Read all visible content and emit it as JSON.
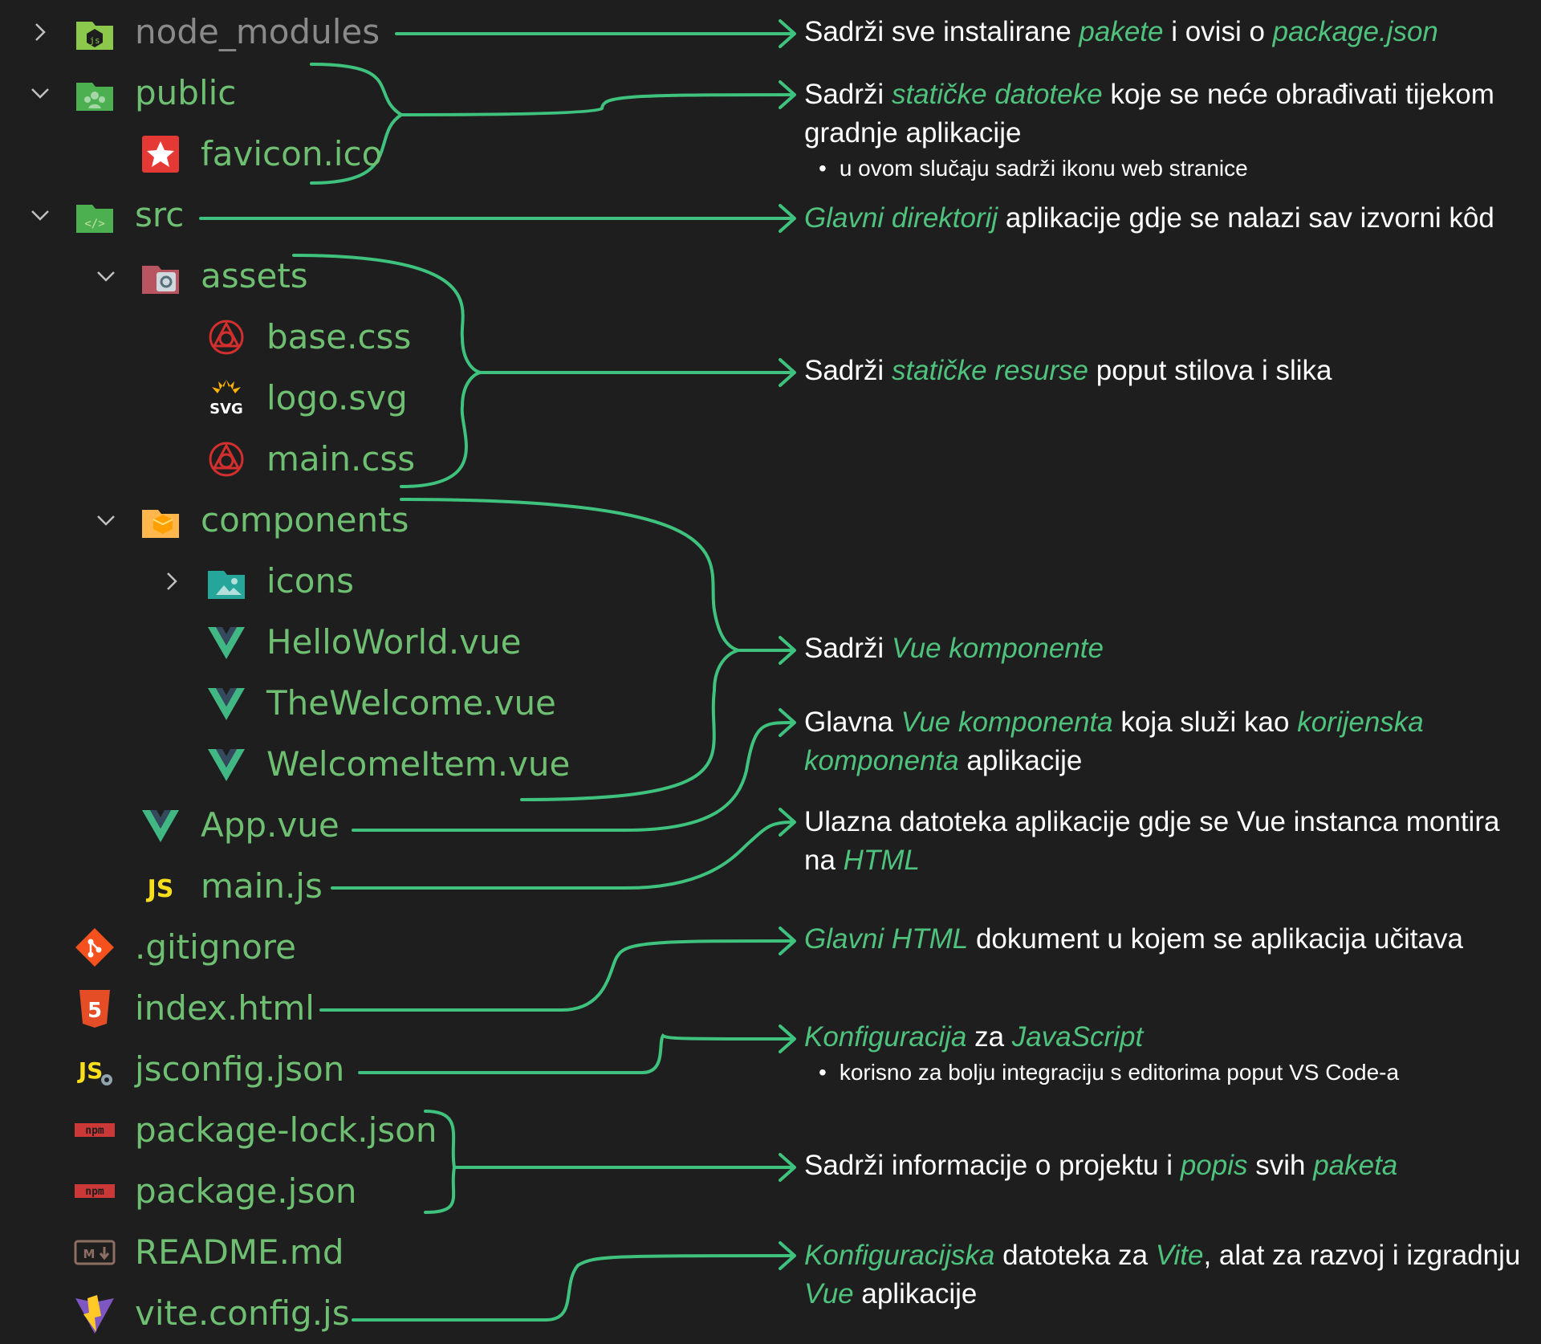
{
  "colors": {
    "background": "#1e1e1e",
    "file_text": "#6fbf73",
    "dim_text": "#8a8a8a",
    "description_text": "#ffffff",
    "highlight": "#4fc27d",
    "connector": "#3ec27d"
  },
  "tree": [
    {
      "name": "node_modules",
      "icon": "nodejs-folder-icon",
      "chevron": "right"
    },
    {
      "name": "public",
      "icon": "public-folder-icon",
      "chevron": "down"
    },
    {
      "name": "favicon.ico",
      "icon": "favicon-star-icon",
      "chevron": "none"
    },
    {
      "name": "src",
      "icon": "src-folder-icon",
      "chevron": "down"
    },
    {
      "name": "assets",
      "icon": "assets-folder-icon",
      "chevron": "down"
    },
    {
      "name": "base.css",
      "icon": "css-icon",
      "chevron": "none"
    },
    {
      "name": "logo.svg",
      "icon": "svg-icon",
      "chevron": "none"
    },
    {
      "name": "main.css",
      "icon": "css-icon",
      "chevron": "none"
    },
    {
      "name": "components",
      "icon": "components-folder-icon",
      "chevron": "down"
    },
    {
      "name": "icons",
      "icon": "images-folder-icon",
      "chevron": "right"
    },
    {
      "name": "HelloWorld.vue",
      "icon": "vue-icon",
      "chevron": "none"
    },
    {
      "name": "TheWelcome.vue",
      "icon": "vue-icon",
      "chevron": "none"
    },
    {
      "name": "WelcomeItem.vue",
      "icon": "vue-icon",
      "chevron": "none"
    },
    {
      "name": "App.vue",
      "icon": "vue-icon",
      "chevron": "none"
    },
    {
      "name": "main.js",
      "icon": "javascript-icon",
      "chevron": "none"
    },
    {
      "name": ".gitignore",
      "icon": "git-icon",
      "chevron": "none"
    },
    {
      "name": "index.html",
      "icon": "html5-icon",
      "chevron": "none"
    },
    {
      "name": "jsconfig.json",
      "icon": "jsconfig-icon",
      "chevron": "none"
    },
    {
      "name": "package-lock.json",
      "icon": "npm-icon",
      "chevron": "none"
    },
    {
      "name": "package.json",
      "icon": "npm-icon",
      "chevron": "none"
    },
    {
      "name": "README.md",
      "icon": "markdown-icon",
      "chevron": "none"
    },
    {
      "name": "vite.config.js",
      "icon": "vite-icon",
      "chevron": "none"
    }
  ],
  "descriptions": [
    {
      "parts": [
        {
          "t": "Sadrži sve instalirane "
        },
        {
          "t": "pakete",
          "h": true
        },
        {
          "t": " i ovisi o "
        },
        {
          "t": "package.json",
          "h": true
        }
      ],
      "bullets": []
    },
    {
      "parts": [
        {
          "t": "Sadrži "
        },
        {
          "t": "statičke datoteke",
          "h": true
        },
        {
          "t": " koje se neće obrađivati tijekom gradnje aplikacije"
        }
      ],
      "bullets": [
        "u ovom slučaju sadrži ikonu web stranice"
      ]
    },
    {
      "parts": [
        {
          "t": "Glavni direktorij",
          "h": true
        },
        {
          "t": " aplikacije gdje se nalazi sav izvorni kôd"
        }
      ],
      "bullets": []
    },
    {
      "parts": [
        {
          "t": "Sadrži "
        },
        {
          "t": "statičke resurse",
          "h": true
        },
        {
          "t": " poput stilova i slika"
        }
      ],
      "bullets": []
    },
    {
      "parts": [
        {
          "t": "Sadrži "
        },
        {
          "t": "Vue komponente",
          "h": true
        }
      ],
      "bullets": []
    },
    {
      "parts": [
        {
          "t": "Glavna "
        },
        {
          "t": "Vue komponenta",
          "h": true
        },
        {
          "t": " koja služi kao "
        },
        {
          "t": "korijenska komponenta",
          "h": true
        },
        {
          "t": " aplikacije"
        }
      ],
      "bullets": []
    },
    {
      "parts": [
        {
          "t": "Ulazna datoteka aplikacije gdje se Vue instanca montira na "
        },
        {
          "t": "HTML",
          "h": true
        }
      ],
      "bullets": []
    },
    {
      "parts": [
        {
          "t": "Glavni HTML",
          "h": true
        },
        {
          "t": " dokument u kojem se aplikacija učitava"
        }
      ],
      "bullets": []
    },
    {
      "parts": [
        {
          "t": "Konfiguracija",
          "h": true
        },
        {
          "t": " za "
        },
        {
          "t": "JavaScript",
          "h": true
        }
      ],
      "bullets": [
        "korisno za bolju integraciju s editorima poput VS Code-a"
      ]
    },
    {
      "parts": [
        {
          "t": "Sadrži informacije o projektu i "
        },
        {
          "t": "popis",
          "h": true
        },
        {
          "t": " svih "
        },
        {
          "t": "paketa",
          "h": true
        }
      ],
      "bullets": []
    },
    {
      "parts": [
        {
          "t": "Konfiguracijska",
          "h": true
        },
        {
          "t": " datoteka za "
        },
        {
          "t": "Vite",
          "h": true
        },
        {
          "t": ", alat za razvoj i izgradnju "
        },
        {
          "t": "Vue",
          "h": true
        },
        {
          "t": " aplikacije"
        }
      ],
      "bullets": []
    }
  ]
}
